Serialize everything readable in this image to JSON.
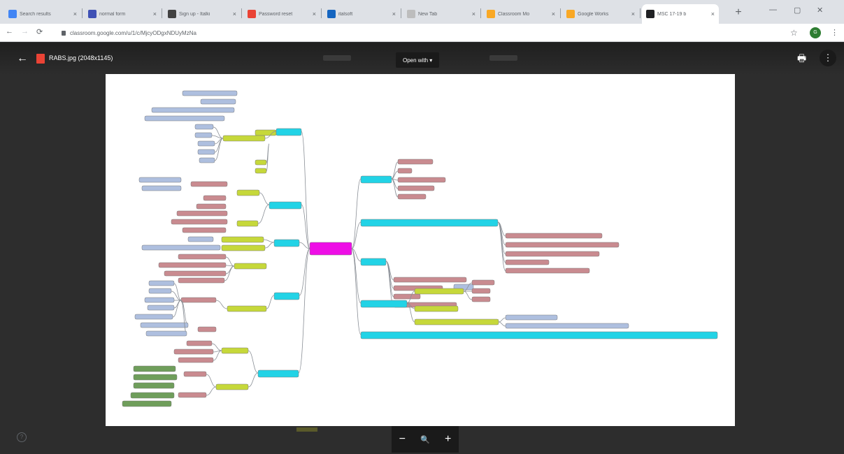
{
  "tabs": [
    {
      "title": "Search results",
      "favicon_color": "#4285f4"
    },
    {
      "title": "normal form",
      "favicon_color": "#3f51b5"
    },
    {
      "title": "Sign up - Italki",
      "favicon_color": "#424242"
    },
    {
      "title": "Password reset",
      "favicon_color": "#ea4335"
    },
    {
      "title": "italsoft",
      "favicon_color": "#1565c0"
    },
    {
      "title": "New Tab",
      "favicon_color": "#bdbdbd"
    },
    {
      "title": "Classroom Mo",
      "favicon_color": "#f9a825"
    },
    {
      "title": "Google Works",
      "favicon_color": "#f9a825"
    },
    {
      "title": "MSC 17-19 b",
      "favicon_color": "#202124"
    }
  ],
  "toolbar": {
    "url": "classroom.google.com/u/1/c/MjcyODgxNDUyMzNa",
    "profile_initial": "G"
  },
  "viewer": {
    "file_name": "RABS.jpg (2048x1145)",
    "open_with_label": "Open with ▾"
  },
  "zoom": {
    "minus": "−",
    "plus": "+"
  },
  "icons": {
    "back": "arrow-left-icon",
    "print": "print-icon",
    "more": "more-vert-icon",
    "help": "help-icon",
    "zoom": "magnify-icon"
  },
  "colors": {
    "center": "#ee0ee6",
    "cyan": "#22d3e6",
    "olive": "#c6d83a",
    "rose": "#c98b90",
    "blue": "#aebfdf",
    "green": "#6f9e5b"
  }
}
